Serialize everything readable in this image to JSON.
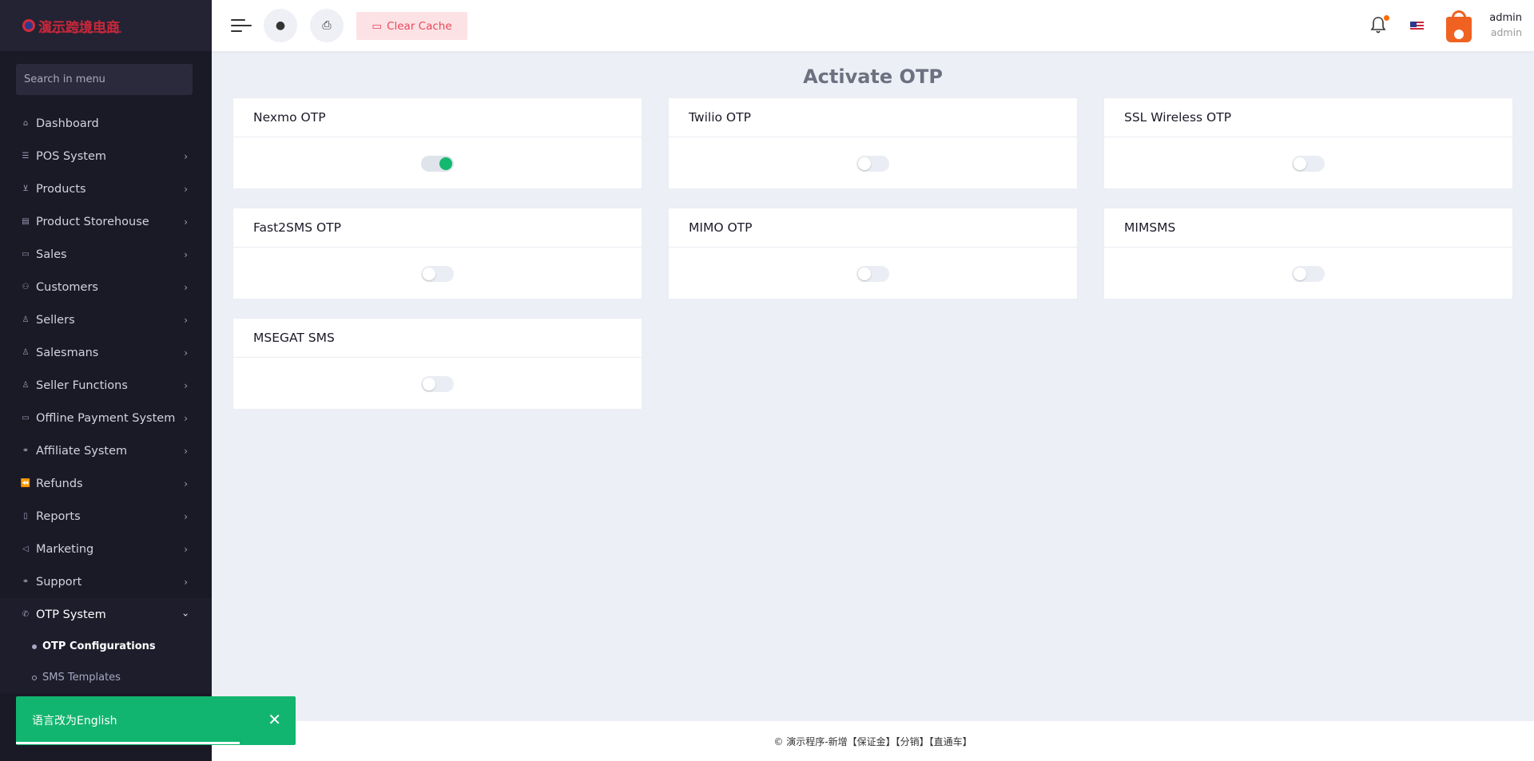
{
  "brand": {
    "logo_text": "演示跨境电商"
  },
  "sidebar": {
    "search_placeholder": "Search in menu",
    "items": [
      {
        "label": "Dashboard",
        "icon": "home-icon",
        "glyph": "⌂",
        "arrow": false
      },
      {
        "label": "POS System",
        "icon": "list-icon",
        "glyph": "☰",
        "arrow": true
      },
      {
        "label": "Products",
        "icon": "cart-icon",
        "glyph": "⊻",
        "arrow": true
      },
      {
        "label": "Product Storehouse",
        "icon": "storehouse-icon",
        "glyph": "▤",
        "arrow": true
      },
      {
        "label": "Sales",
        "icon": "money-icon",
        "glyph": "▭",
        "arrow": true
      },
      {
        "label": "Customers",
        "icon": "users-icon",
        "glyph": "⚇",
        "arrow": true
      },
      {
        "label": "Sellers",
        "icon": "user-icon",
        "glyph": "♙",
        "arrow": true
      },
      {
        "label": "Salesmans",
        "icon": "user-icon",
        "glyph": "♙",
        "arrow": true
      },
      {
        "label": "Seller Functions",
        "icon": "user-icon",
        "glyph": "♙",
        "arrow": true
      },
      {
        "label": "Offline Payment System",
        "icon": "money-icon",
        "glyph": "▭",
        "arrow": true
      },
      {
        "label": "Affiliate System",
        "icon": "link-icon",
        "glyph": "⚭",
        "arrow": true
      },
      {
        "label": "Refunds",
        "icon": "backward-icon",
        "glyph": "⏪",
        "arrow": true
      },
      {
        "label": "Reports",
        "icon": "file-icon",
        "glyph": "▯",
        "arrow": true
      },
      {
        "label": "Marketing",
        "icon": "bullhorn-icon",
        "glyph": "◁",
        "arrow": true
      },
      {
        "label": "Support",
        "icon": "link-icon",
        "glyph": "⚭",
        "arrow": true
      },
      {
        "label": "OTP System",
        "icon": "phone-icon",
        "glyph": "✆",
        "arrow": true
      }
    ],
    "subitems": [
      {
        "label": "OTP Configurations",
        "active": true
      },
      {
        "label": "SMS Templates",
        "active": false
      }
    ]
  },
  "topbar": {
    "clear_cache_label": "Clear Cache",
    "user_name": "admin",
    "user_role": "admin"
  },
  "page": {
    "title": "Activate OTP",
    "cards": [
      {
        "name": "Nexmo OTP",
        "enabled": true
      },
      {
        "name": "Twilio OTP",
        "enabled": false
      },
      {
        "name": "SSL Wireless OTP",
        "enabled": false
      },
      {
        "name": "Fast2SMS OTP",
        "enabled": false
      },
      {
        "name": "MIMO OTP",
        "enabled": false
      },
      {
        "name": "MIMSMS",
        "enabled": false
      },
      {
        "name": "MSEGAT SMS",
        "enabled": false
      }
    ]
  },
  "footer": {
    "text": "© 演示程序-新增【保证金】【分销】【直通车】"
  },
  "toast": {
    "message": "语言改为English",
    "progress": 0.8
  },
  "colors": {
    "sidebar_bg": "#1a1a27",
    "accent_green": "#14b86f",
    "clear_cache_text": "#e8465a",
    "notification_dot": "#ff6a00"
  }
}
